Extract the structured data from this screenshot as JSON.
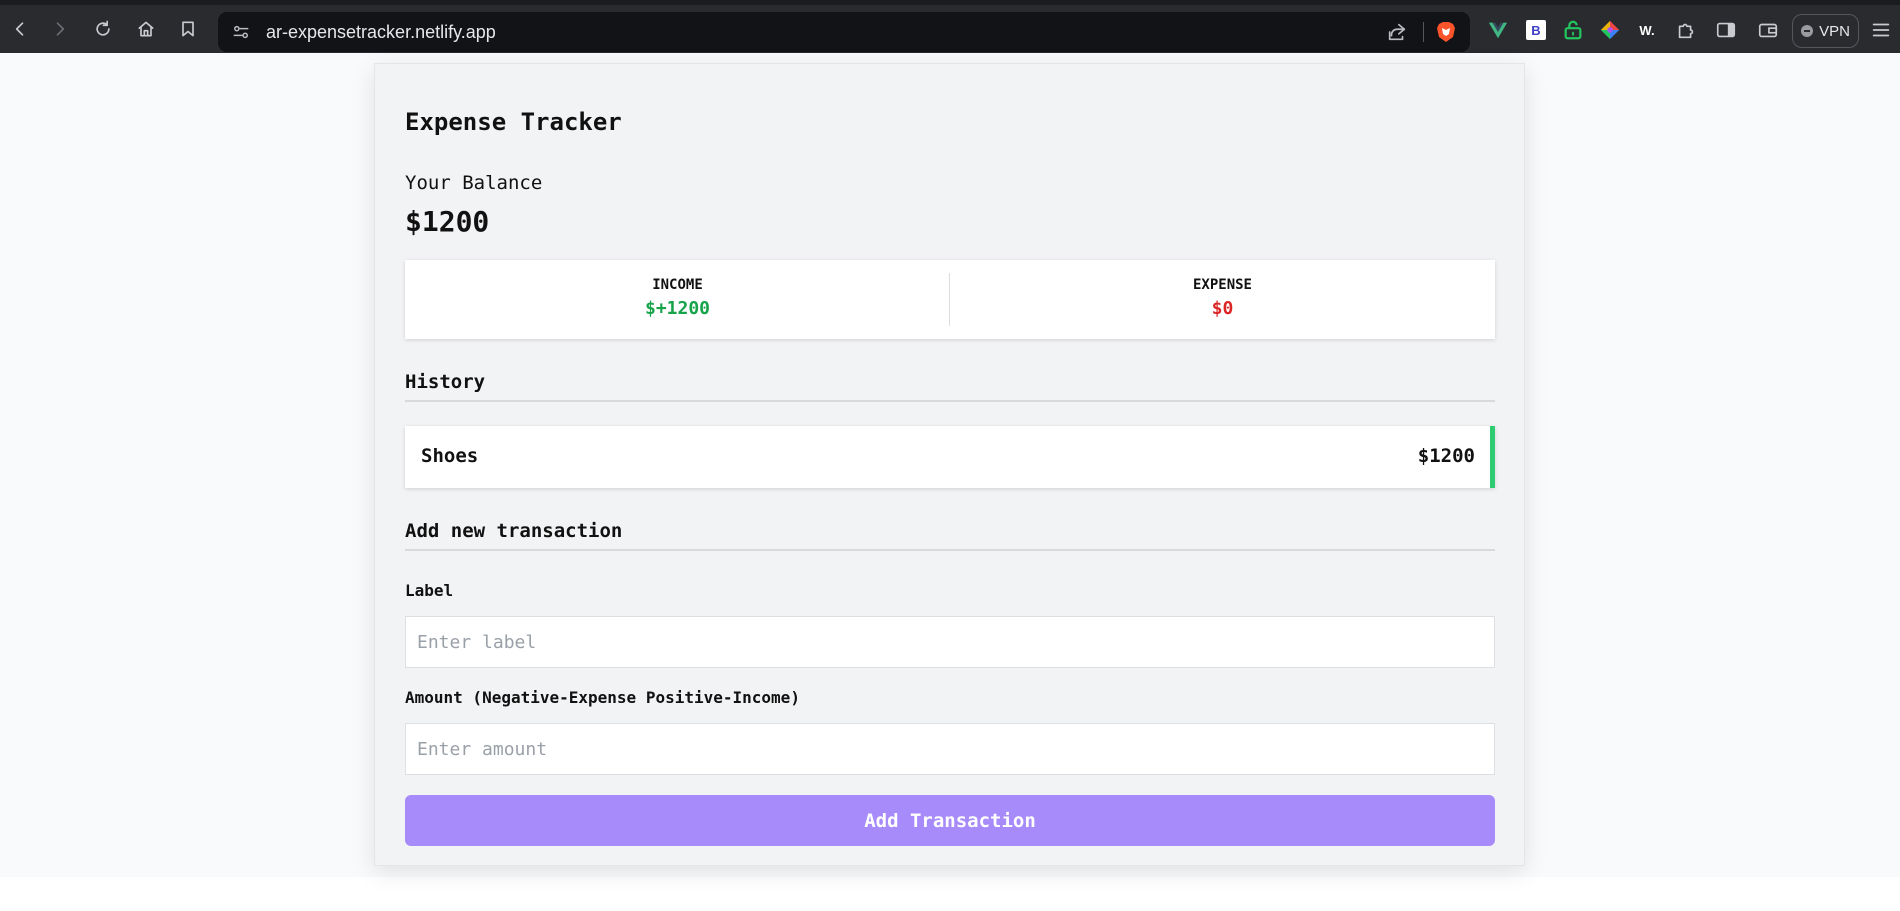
{
  "browser": {
    "url": "ar-expensetracker.netlify.app",
    "vpn_label": "VPN",
    "extensions": [
      {
        "name": "vue-devtools",
        "icon": "vue-icon",
        "color": "#41b883"
      },
      {
        "name": "b-extension",
        "icon": "b-icon",
        "text": "B"
      },
      {
        "name": "lock-extension",
        "icon": "green-lock-icon",
        "color": "#22c55e"
      },
      {
        "name": "color-extension",
        "icon": "color-diamond-icon"
      },
      {
        "name": "w-extension",
        "icon": "w-icon",
        "text": "W."
      },
      {
        "name": "extensions",
        "icon": "puzzle-icon"
      },
      {
        "name": "sidebar",
        "icon": "sidebar-icon"
      },
      {
        "name": "wallet",
        "icon": "wallet-icon"
      }
    ]
  },
  "app": {
    "title": "Expense Tracker",
    "balance_label": "Your Balance",
    "balance_value": "$1200",
    "income_label": "INCOME",
    "income_value": "$+1200",
    "expense_label": "EXPENSE",
    "expense_value": "$0",
    "history_title": "History",
    "transactions": [
      {
        "label": "Shoes",
        "amount": "$1200",
        "type": "income"
      }
    ],
    "add_title": "Add new transaction",
    "label_field": {
      "label": "Label",
      "placeholder": "Enter label",
      "value": ""
    },
    "amount_field": {
      "label": "Amount (Negative-Expense Positive-Income)",
      "placeholder": "Enter amount",
      "value": ""
    },
    "add_button": "Add Transaction"
  },
  "colors": {
    "income": "#16a34a",
    "expense": "#dc2626",
    "accent": "#a78bfa",
    "income_border": "#2ecc71"
  }
}
